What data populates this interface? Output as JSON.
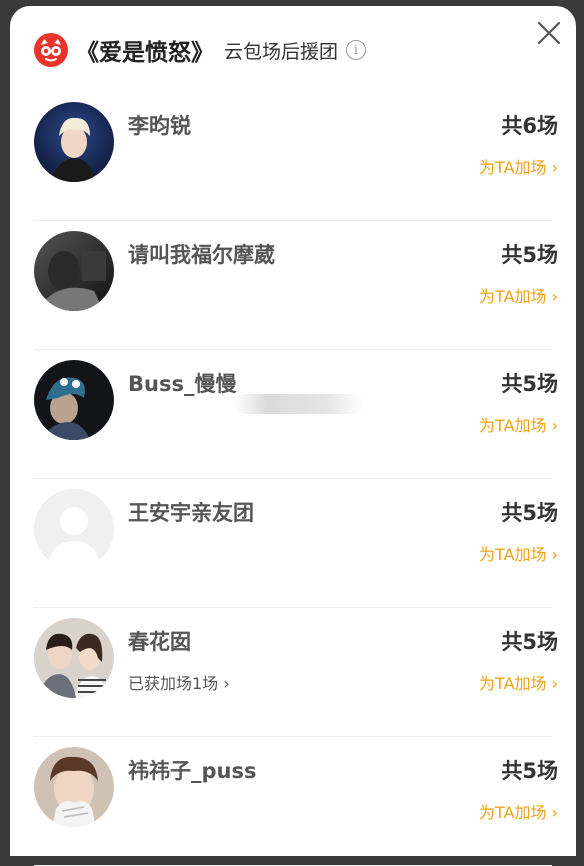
{
  "header": {
    "film_title": "《爱是愤怒》",
    "subtitle": "云包场后援团",
    "info_icon": "info-icon",
    "close_icon": "close-icon",
    "logo_icon": "maoyan-cat-logo",
    "logo_color": "#e8352b"
  },
  "accent_color": "#f0a214",
  "supporters": [
    {
      "name": "李昀锐",
      "count": "共6场",
      "action": "为TA加场 ›",
      "sub": ""
    },
    {
      "name": "请叫我福尔摩葳",
      "count": "共5场",
      "action": "为TA加场 ›",
      "sub": ""
    },
    {
      "name": "Buss_慢慢",
      "count": "共5场",
      "action": "为TA加场 ›",
      "sub": ""
    },
    {
      "name": "王安宇亲友团",
      "count": "共5场",
      "action": "为TA加场 ›",
      "sub": ""
    },
    {
      "name": "春花囡",
      "count": "共5场",
      "action": "为TA加场 ›",
      "sub": "已获加场1场 ›"
    },
    {
      "name": "祎祎子_puss",
      "count": "共5场",
      "action": "为TA加场 ›",
      "sub": ""
    }
  ]
}
